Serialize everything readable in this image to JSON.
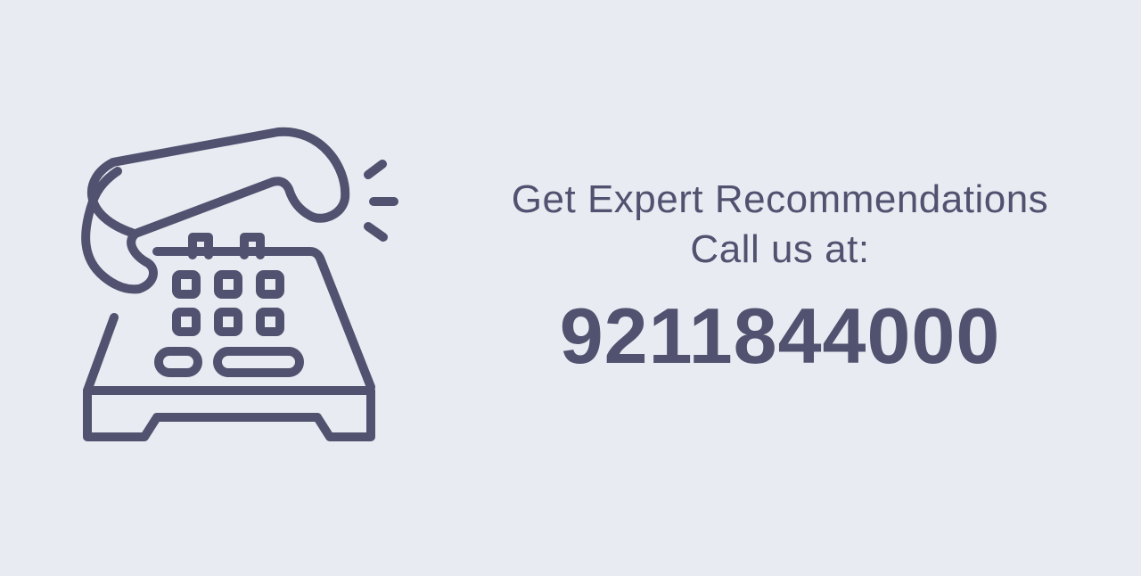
{
  "colors": {
    "background": "#e9ebf2",
    "accent": "#50526f"
  },
  "icon": {
    "name": "telephone-icon"
  },
  "promo": {
    "headline": "Get Expert Recommendations",
    "subheadline": "Call us at:",
    "phone_number": "9211844000"
  }
}
